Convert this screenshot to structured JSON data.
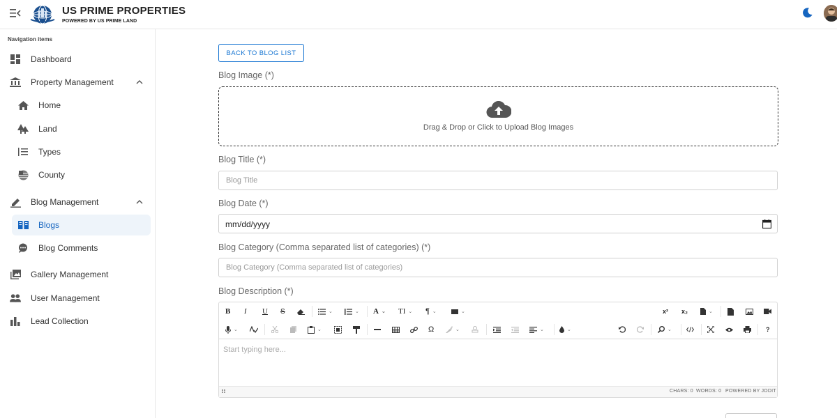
{
  "header": {
    "brand_title": "US PRIME PROPERTIES",
    "brand_subtitle": "POWERED BY US PRIME LAND",
    "accent_color": "#1565c0"
  },
  "sidebar": {
    "heading": "Navigation items",
    "items": [
      {
        "label": "Dashboard",
        "icon": "dashboard-icon"
      },
      {
        "label": "Property Management",
        "icon": "bank-icon",
        "expanded": true
      },
      {
        "label": "Home",
        "icon": "home-icon"
      },
      {
        "label": "Land",
        "icon": "forest-icon"
      },
      {
        "label": "Types",
        "icon": "list-numbered-icon"
      },
      {
        "label": "County",
        "icon": "flag-icon"
      },
      {
        "label": "Blog Management",
        "icon": "edit-icon",
        "expanded": true
      },
      {
        "label": "Blogs",
        "icon": "book-icon",
        "active": true
      },
      {
        "label": "Blog Comments",
        "icon": "comment-icon"
      },
      {
        "label": "Gallery Management",
        "icon": "gallery-icon"
      },
      {
        "label": "User Management",
        "icon": "people-icon"
      },
      {
        "label": "Lead Collection",
        "icon": "bar-chart-icon"
      }
    ]
  },
  "main": {
    "back_button": "BACK TO BLOG LIST",
    "image_label": "Blog Image (*)",
    "dropzone_text": "Drag & Drop or Click to Upload Blog Images",
    "title_label": "Blog Title (*)",
    "title_placeholder": "Blog Title",
    "date_label": "Blog Date (*)",
    "date_value": "mm/dd/yyyy",
    "category_label": "Blog Category (Comma separated list of categories) (*)",
    "category_placeholder": "Blog Category (Comma separated list of categories)",
    "description_label": "Blog Description (*)"
  },
  "editor": {
    "placeholder": "Start typing here...",
    "chars": "CHARS: 0",
    "words": "WORDS: 0",
    "powered_by": "POWERED BY JODIT",
    "bold": "B",
    "italic": "I",
    "underline": "U",
    "strike": "S",
    "font": "A",
    "font_size": "TI",
    "paragraph": "¶",
    "superscript": "x²",
    "subscript": "x₂",
    "omega": "Ω",
    "help": "?"
  }
}
